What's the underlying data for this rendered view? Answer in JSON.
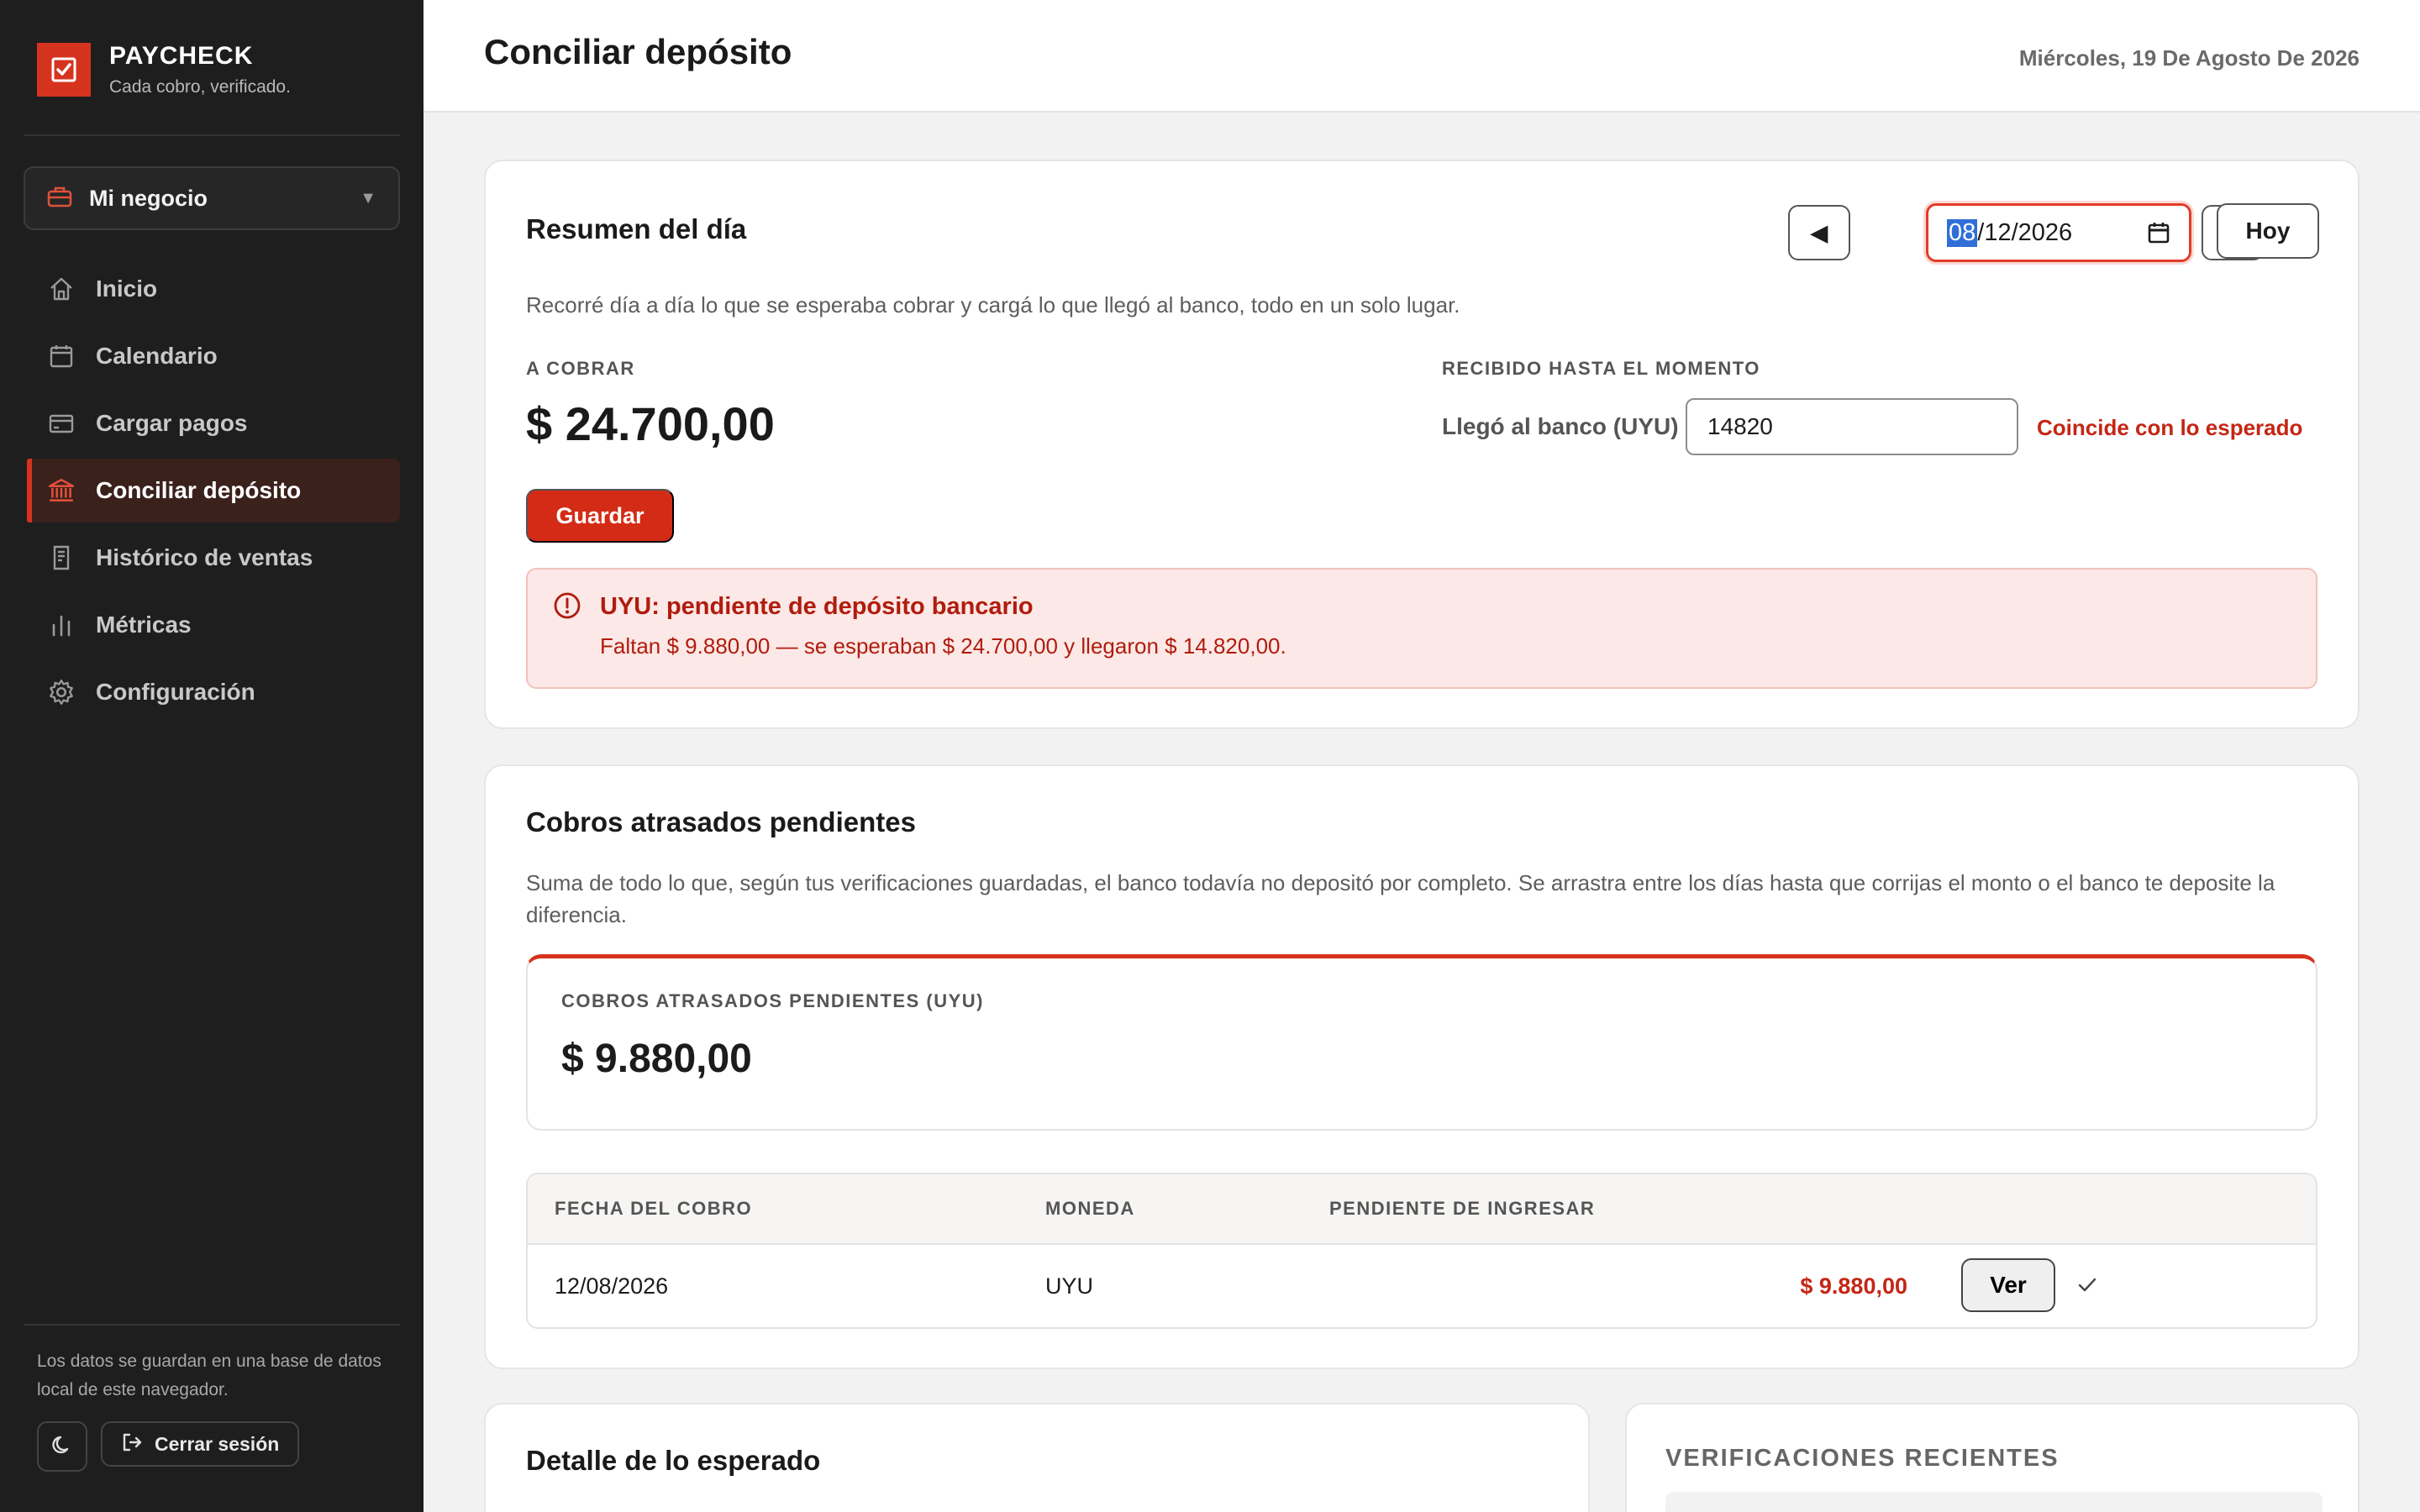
{
  "brand": {
    "name": "PAYCHECK",
    "tagline": "Cada cobro, verificado."
  },
  "business": {
    "label": "Mi negocio"
  },
  "nav": [
    {
      "label": "Inicio",
      "icon": "home-icon"
    },
    {
      "label": "Calendario",
      "icon": "calendar-icon"
    },
    {
      "label": "Cargar pagos",
      "icon": "card-icon"
    },
    {
      "label": "Conciliar depósito",
      "icon": "bank-icon",
      "active": true
    },
    {
      "label": "Histórico de ventas",
      "icon": "receipt-icon"
    },
    {
      "label": "Métricas",
      "icon": "bar-chart-icon"
    },
    {
      "label": "Configuración",
      "icon": "gear-icon"
    }
  ],
  "sidebar_footer": {
    "note": "Los datos se guardan en una base de datos local de este navegador.",
    "logout": "Cerrar sesión"
  },
  "header": {
    "title": "Conciliar depósito",
    "date": "Miércoles, 19 De Agosto De 2026"
  },
  "summary": {
    "title": "Resumen del día",
    "date_day": "08",
    "date_rest": "/12/2026",
    "today_label": "Hoy",
    "description": "Recorré día a día lo que se esperaba cobrar y cargá lo que llegó al banco, todo en un solo lugar.",
    "to_collect_label": "A COBRAR",
    "to_collect_value": "$ 24.700,00",
    "received_label": "RECIBIDO HASTA EL MOMENTO",
    "bank_label": "Llegó al banco (UYU)",
    "bank_value": "14820",
    "match_text": "Coincide con lo esperado",
    "save_label": "Guardar",
    "alert_title": "UYU: pendiente de depósito bancario",
    "alert_text": "Faltan $ 9.880,00 — se esperaban $ 24.700,00 y llegaron $ 14.820,00."
  },
  "overdue": {
    "title": "Cobros atrasados pendientes",
    "description": "Suma de todo lo que, según tus verificaciones guardadas, el banco todavía no depositó por completo. Se arrastra entre los días hasta que corrijas el monto o el banco te deposite la diferencia.",
    "total_label": "COBROS ATRASADOS PENDIENTES (UYU)",
    "total_value": "$ 9.880,00",
    "columns": [
      "FECHA DEL COBRO",
      "MONEDA",
      "PENDIENTE DE INGRESAR"
    ],
    "rows": [
      {
        "date": "12/08/2026",
        "currency": "UYU",
        "pending": "$ 9.880,00",
        "action": "Ver"
      }
    ]
  },
  "expected": {
    "title": "Detalle de lo esperado"
  },
  "recent": {
    "title": "VERIFICACIONES RECIENTES"
  },
  "colors": {
    "accent": "#d6331f",
    "sidebar": "#1e1e1e",
    "alert_bg": "#fce8e6"
  }
}
